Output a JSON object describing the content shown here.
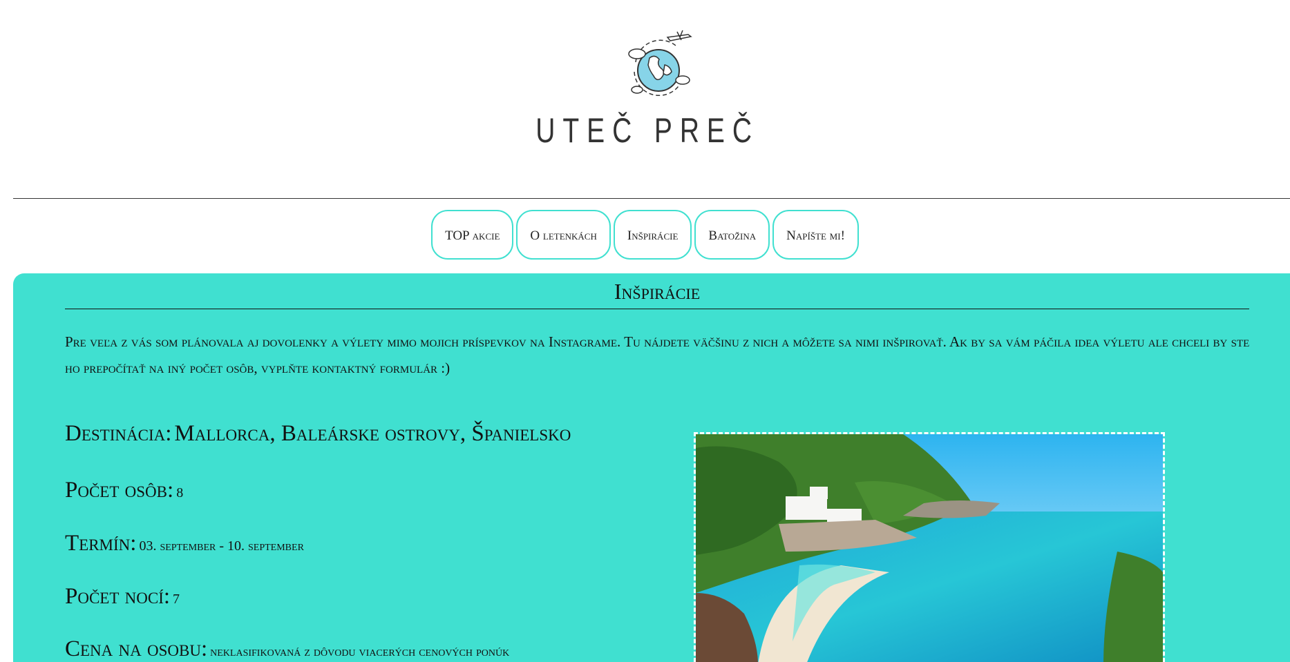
{
  "site": {
    "title": "UTEČ PREČ"
  },
  "nav": {
    "items": [
      {
        "label": "TOP akcie",
        "name": "nav-top-akcie"
      },
      {
        "label": "O letenkách",
        "name": "nav-o-letenkach"
      },
      {
        "label": "Inšpirácie",
        "name": "nav-inspiracie"
      },
      {
        "label": "Batožina",
        "name": "nav-batozina"
      },
      {
        "label": "Napíšte mi!",
        "name": "nav-napiste-mi"
      }
    ]
  },
  "page": {
    "title": "Inšpirácie",
    "intro": "Pre veľa z vás som plánovala aj dovolenky a výlety mimo mojich príspevkov na Instagrame. Tu nájdete väčšinu z nich a môžete sa nimi inšpirovať. Ak by sa vám páčila idea výletu ale chceli by ste ho prepočítať na iný počet osôb, vyplňte kontaktný formulár :)"
  },
  "trip": {
    "destination_label": "Destinácia:",
    "destination_value": "Mallorca, Baleárske ostrovy, Španielsko",
    "persons_label": "Počet osôb:",
    "persons_value": "8",
    "term_label": "Termín:",
    "term_value": "03. september - 10. september",
    "nights_label": "Počet nocí:",
    "nights_value": "7",
    "price_label": "Cena na osobu:",
    "price_value": "neklasifikovaná z dôvodu viacerých cenových ponúk"
  },
  "colors": {
    "accent": "#40e0d0",
    "text": "#111111"
  }
}
